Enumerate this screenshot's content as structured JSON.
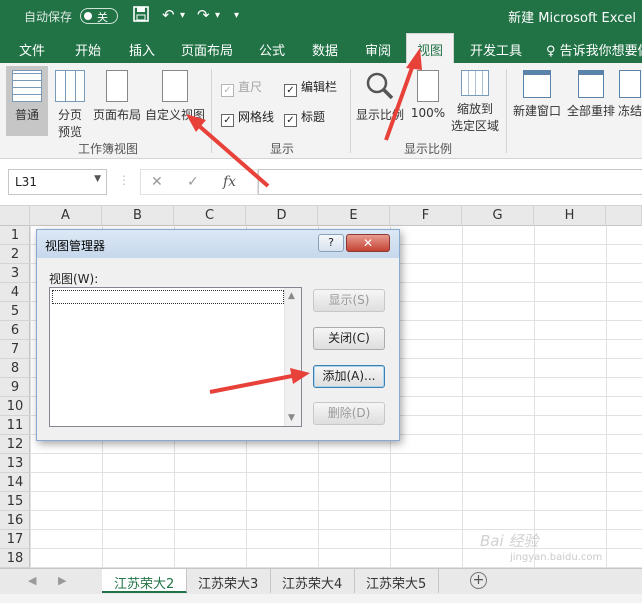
{
  "titlebar": {
    "autosave_label": "自动保存",
    "autosave_state": "关",
    "doc_title": "新建 Microsoft Excel"
  },
  "tabs": [
    {
      "label": "文件"
    },
    {
      "label": "开始"
    },
    {
      "label": "插入"
    },
    {
      "label": "页面布局"
    },
    {
      "label": "公式"
    },
    {
      "label": "数据"
    },
    {
      "label": "审阅"
    },
    {
      "label": "视图",
      "active": true
    },
    {
      "label": "开发工具"
    }
  ],
  "tell_me": "告诉我你想要做",
  "ribbon": {
    "workbook_views": {
      "group_label": "工作簿视图",
      "normal": "普通",
      "page_break_1": "分页",
      "page_break_2": "预览",
      "page_layout": "页面布局",
      "custom_views": "自定义视图"
    },
    "show": {
      "group_label": "显示",
      "ruler": "直尺",
      "ruler_checked": true,
      "ruler_disabled": true,
      "formula_bar": "编辑栏",
      "formula_bar_checked": true,
      "gridlines": "网格线",
      "gridlines_checked": true,
      "headings": "标题",
      "headings_checked": true
    },
    "zoom": {
      "group_label": "显示比例",
      "zoom": "显示比例",
      "hundred": "100%",
      "zoom_to_sel_1": "缩放到",
      "zoom_to_sel_2": "选定区域"
    },
    "window": {
      "new_window": "新建窗口",
      "arrange_all": "全部重排",
      "freeze": "冻结"
    }
  },
  "formula_bar": {
    "name_box": "L31",
    "fx": "fx",
    "value": ""
  },
  "columns": [
    "A",
    "B",
    "C",
    "D",
    "E",
    "F",
    "G",
    "H"
  ],
  "rows": [
    "1",
    "2",
    "3",
    "4",
    "5",
    "6",
    "7",
    "8",
    "9",
    "10",
    "11",
    "12",
    "13",
    "14",
    "15",
    "16",
    "17",
    "18"
  ],
  "sheets": [
    {
      "name": "江苏荣大2",
      "active": true
    },
    {
      "name": "江苏荣大3"
    },
    {
      "name": "江苏荣大4"
    },
    {
      "name": "江苏荣大5"
    }
  ],
  "dialog": {
    "title": "视图管理器",
    "help": "?",
    "close": "✕",
    "list_label": "视图(W):",
    "buttons": {
      "show": "显示(S)",
      "close": "关闭(C)",
      "add": "添加(A)...",
      "delete": "删除(D)"
    }
  },
  "watermark": {
    "line1": "Bai 经验",
    "line2": "jingyan.baidu.com"
  },
  "colors": {
    "accent": "#217346",
    "arrow": "#e8413a"
  }
}
